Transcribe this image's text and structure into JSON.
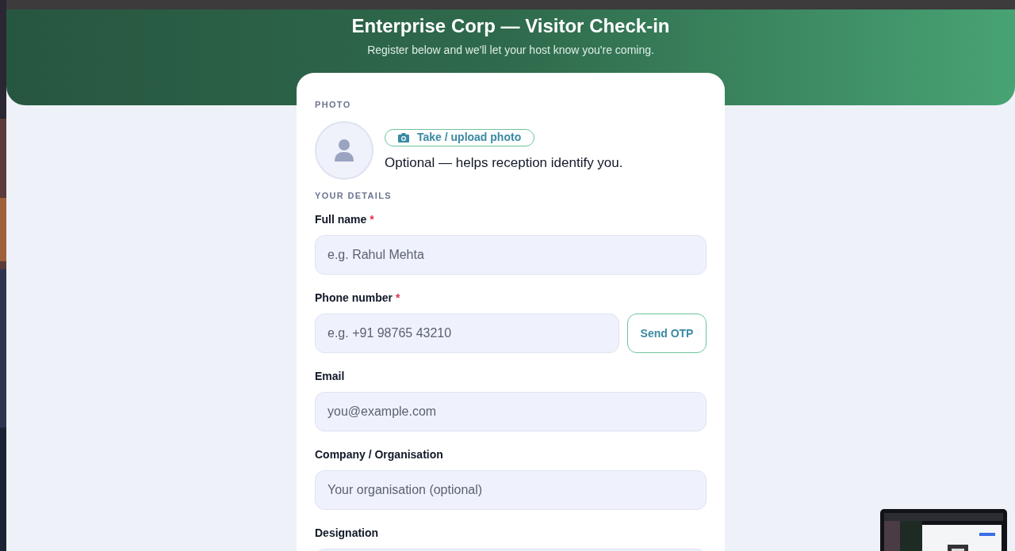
{
  "header": {
    "title": "Enterprise Corp — Visitor Check-in",
    "subtitle": "Register below and we'll let your host know you're coming."
  },
  "photo": {
    "section_label": "PHOTO",
    "button": "Take / upload photo",
    "hint": "Optional — helps reception identify you."
  },
  "details": {
    "section_label": "YOUR DETAILS",
    "fields": [
      {
        "label": "Full name",
        "required": true,
        "placeholder": "e.g. Rahul Mehta"
      },
      {
        "label": "Phone number",
        "required": true,
        "placeholder": "e.g. +91 98765 43210",
        "action": "Send OTP"
      },
      {
        "label": "Email",
        "required": false,
        "placeholder": "you@example.com"
      },
      {
        "label": "Company / Organisation",
        "required": false,
        "placeholder": "Your organisation (optional)"
      },
      {
        "label": "Designation",
        "required": false
      }
    ]
  },
  "required_mark": "*"
}
